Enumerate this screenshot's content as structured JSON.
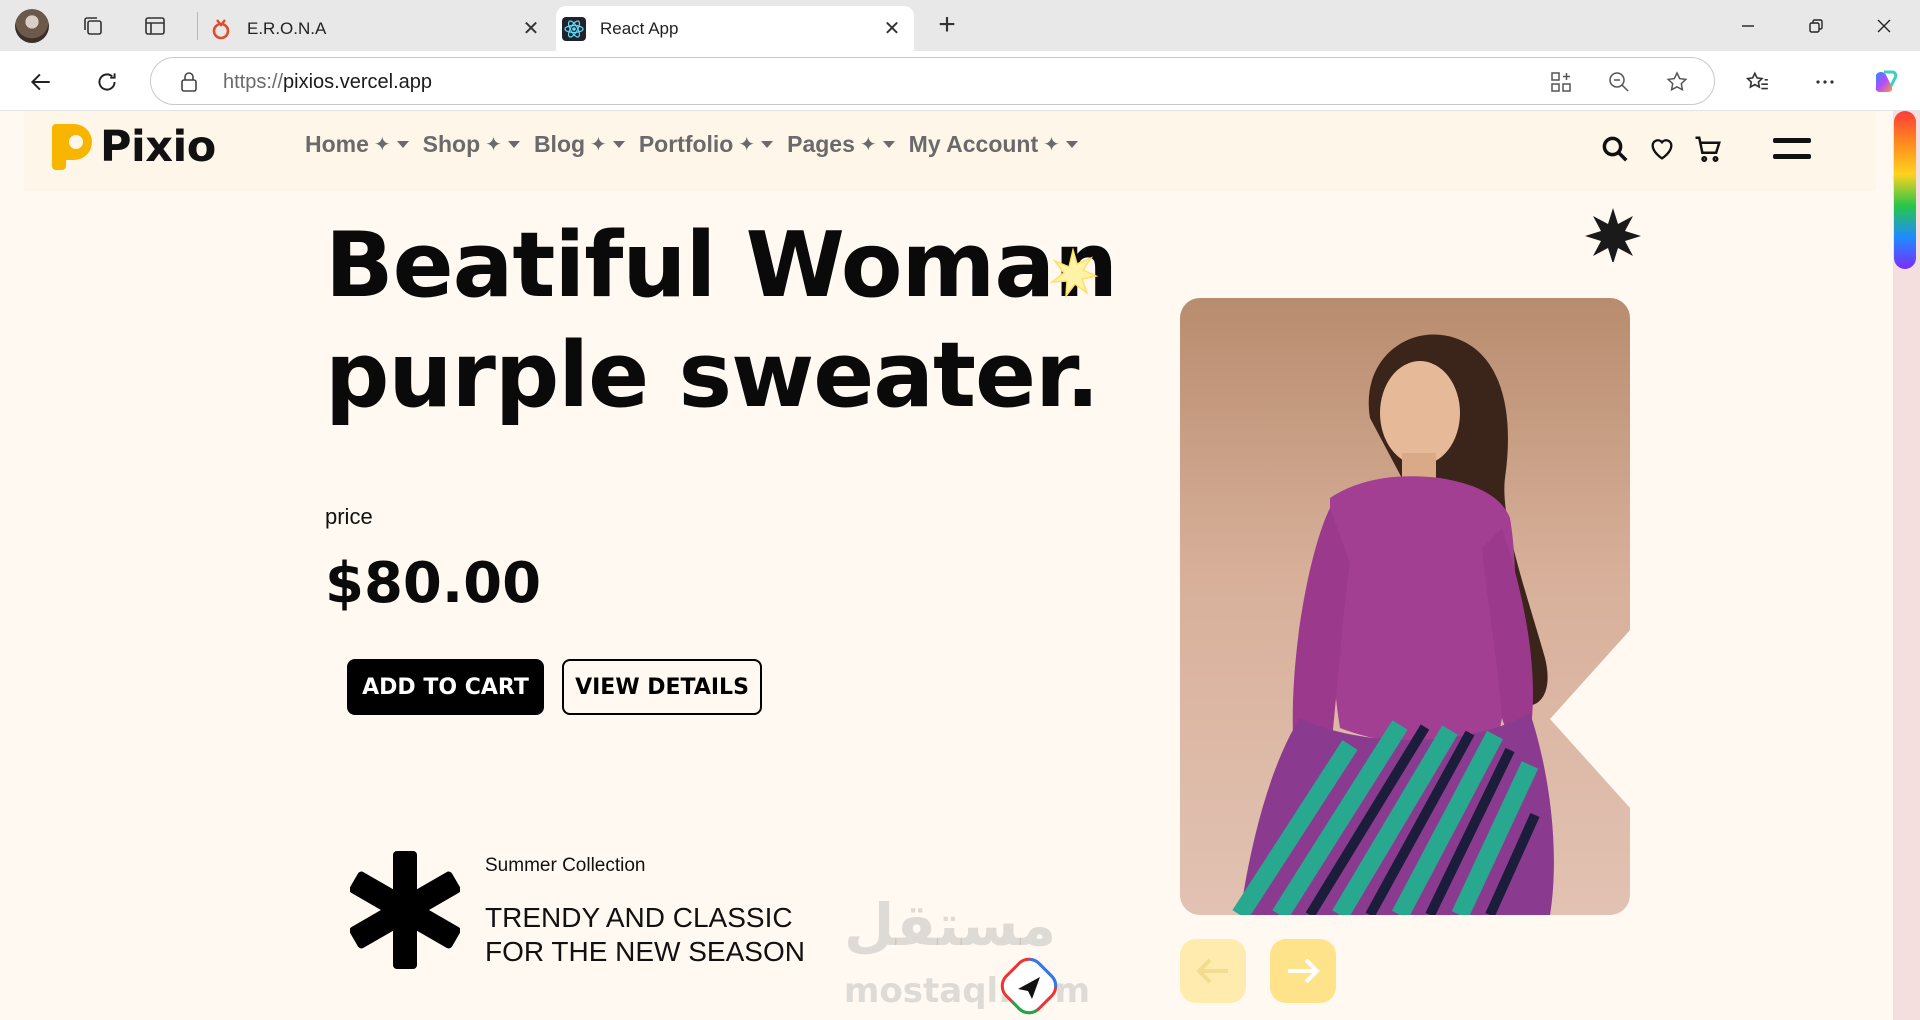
{
  "browser": {
    "tabs": [
      {
        "title": "E.R.O.N.A",
        "icon": "erona-favicon",
        "active": false
      },
      {
        "title": "React App",
        "icon": "react-favicon",
        "active": true
      }
    ],
    "url_protocol": "https://",
    "url_host": "pixios.vercel.app"
  },
  "site": {
    "logo_text": "Pixio",
    "brand_color": "#f7b500",
    "menu": [
      {
        "label": "Home"
      },
      {
        "label": "Shop"
      },
      {
        "label": "Blog"
      },
      {
        "label": "Portfolio"
      },
      {
        "label": "Pages"
      },
      {
        "label": "My Account"
      }
    ],
    "menu_marker": "✦"
  },
  "hero": {
    "title_line1": "Beatiful Woman",
    "title_line2": "purple sweater.",
    "price_label": "price",
    "price": "$80.00",
    "add_to_cart": "ADD TO CART",
    "view_details": "VIEW DETAILS",
    "collection_small": "Summer Collection",
    "collection_line1": "TRENDY AND CLASSIC",
    "collection_line2": "FOR THE NEW SEASON",
    "accent_color": "#ffe38a"
  },
  "watermark": {
    "arabic": "مستقل",
    "latin": "mostaql.com"
  }
}
